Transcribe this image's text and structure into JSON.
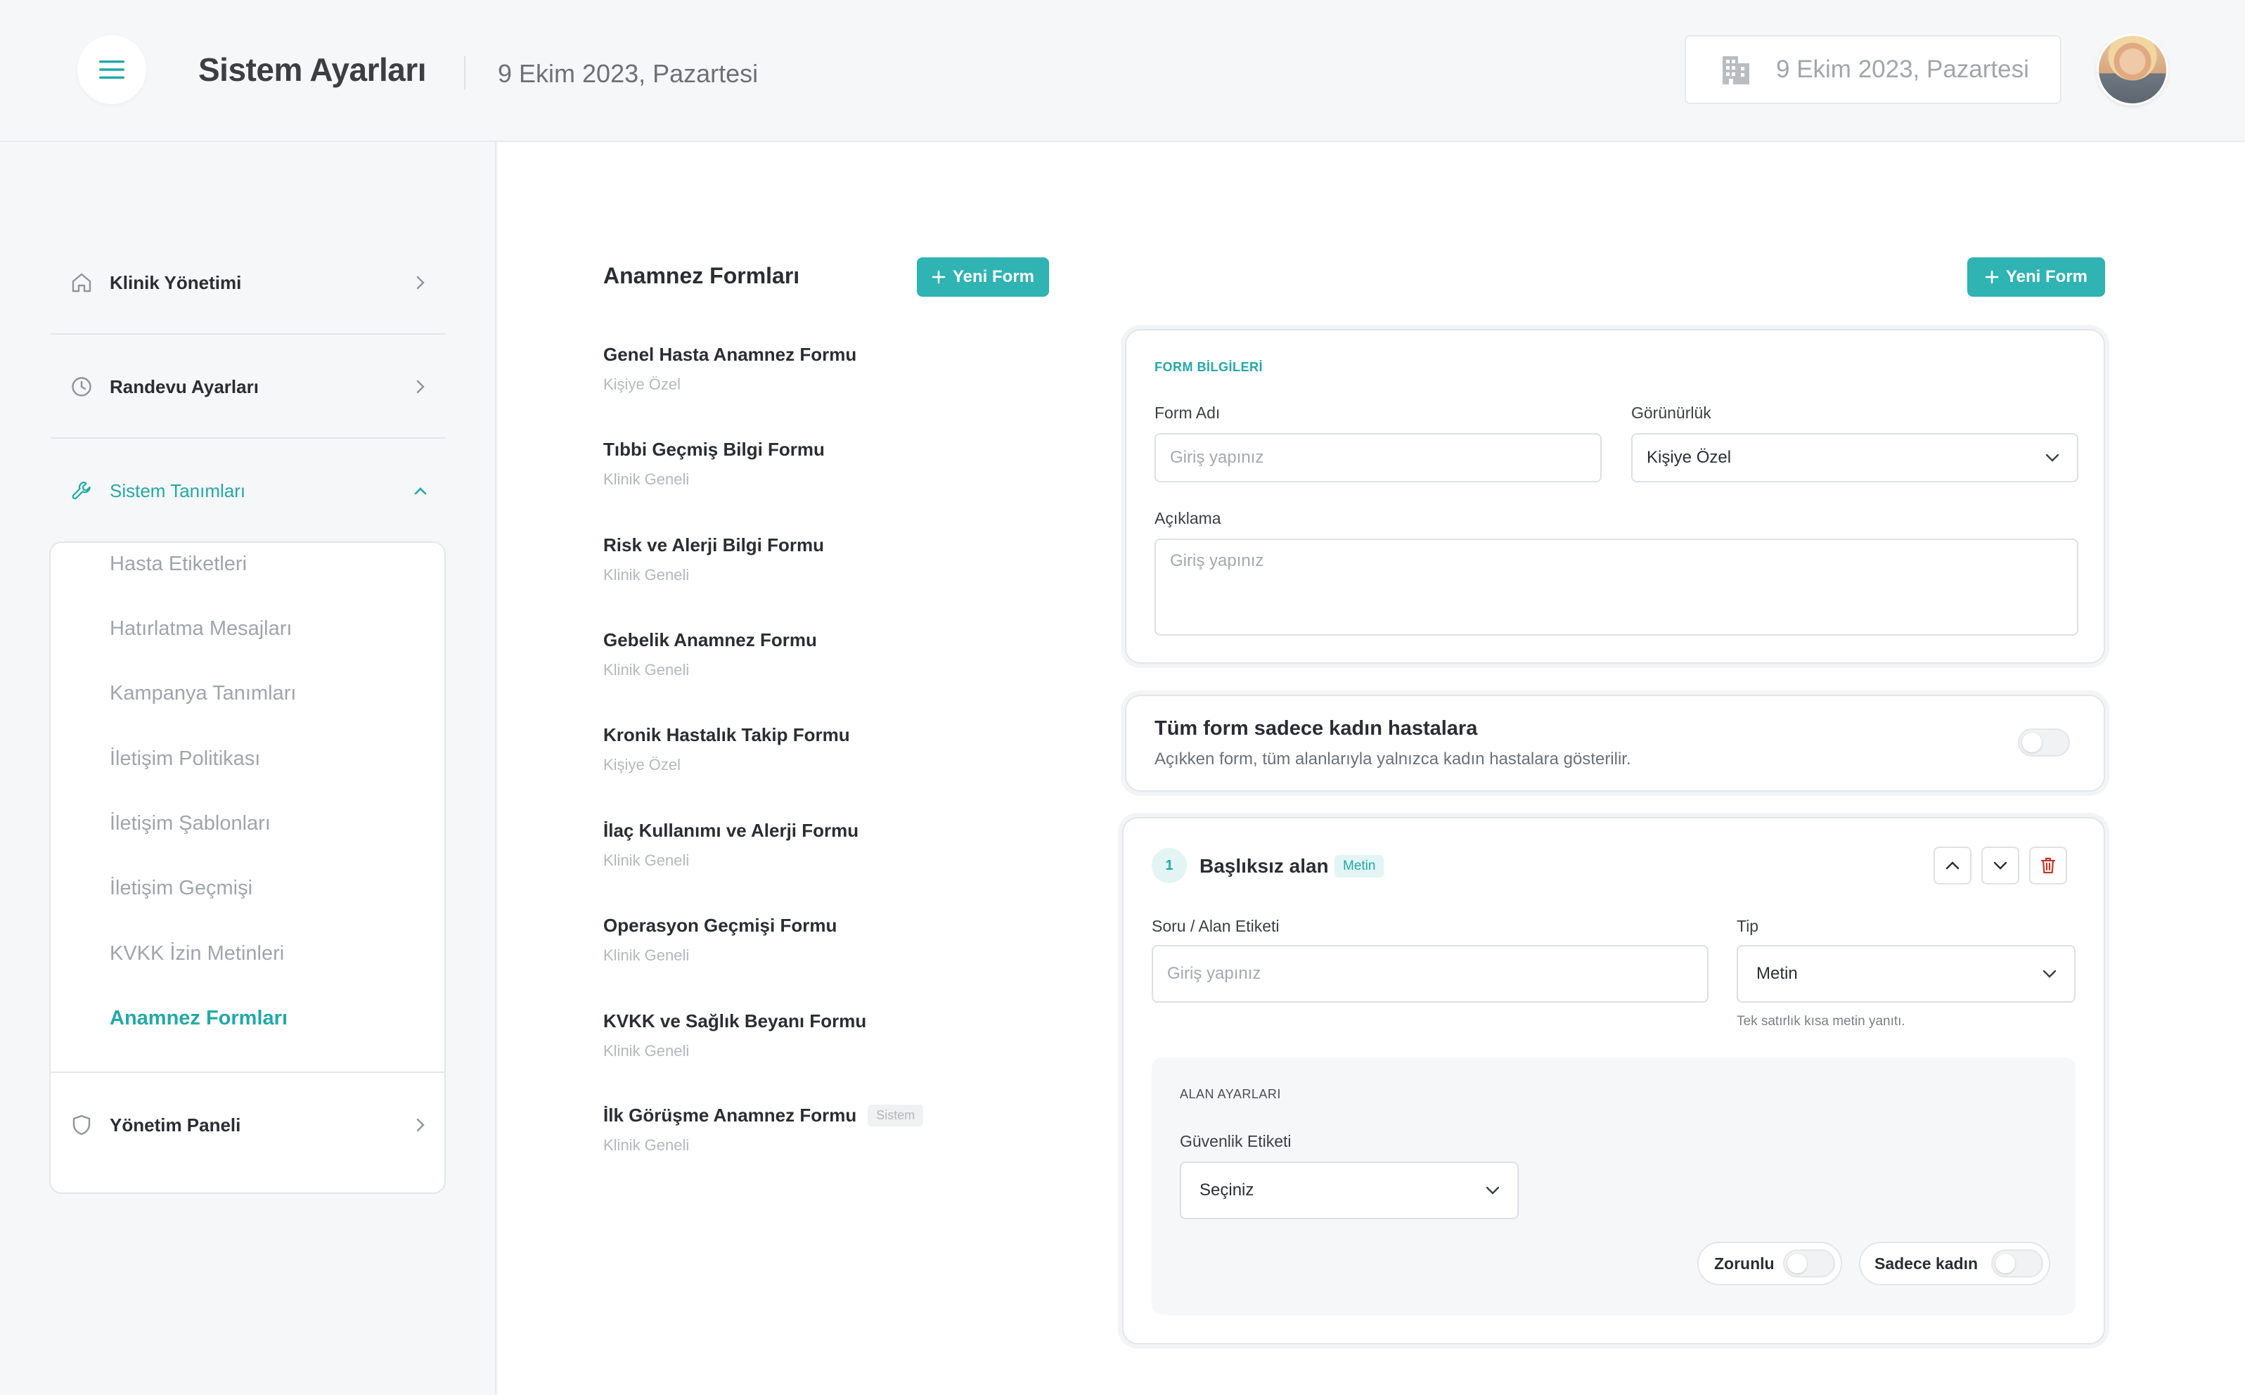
{
  "header": {
    "title": "Sistem Ayarları",
    "date": "9 Ekim 2023, Pazartesi",
    "clinic_date": "9 Ekim 2023, Pazartesi",
    "menu_icon": "hamburger-menu-icon",
    "clinic_icon": "building-icon"
  },
  "sidebar": {
    "items": [
      {
        "label": "Klinik Yönetimi",
        "icon": "home-icon"
      },
      {
        "label": "Randevu Ayarları",
        "icon": "clock-icon"
      },
      {
        "label": "Sistem Tanımları",
        "icon": "wrench-icon",
        "expanded": true
      },
      {
        "label": "Yönetim Paneli",
        "icon": "shield-icon"
      }
    ],
    "subitems": [
      "Hasta Etiketleri",
      "Hatırlatma Mesajları",
      "Kampanya Tanımları",
      "İletişim Politikası",
      "İletişim Şablonları",
      "İletişim Geçmişi",
      "KVKK İzin Metinleri",
      "Anamnez Formları"
    ],
    "active_subitem": "Anamnez Formları"
  },
  "list": {
    "title": "Anamnez Formları",
    "new_button": "Yeni Form",
    "forms": [
      {
        "name": "Genel Hasta Anamnez Formu",
        "scope": "Kişiye Özel"
      },
      {
        "name": "Tıbbi Geçmiş Bilgi Formu",
        "scope": "Klinik Geneli"
      },
      {
        "name": "Risk ve Alerji Bilgi Formu",
        "scope": "Klinik Geneli"
      },
      {
        "name": "Gebelik Anamnez Formu",
        "scope": "Klinik Geneli"
      },
      {
        "name": "Kronik Hastalık Takip Formu",
        "scope": "Kişiye Özel"
      },
      {
        "name": "İlaç Kullanımı ve Alerji Formu",
        "scope": "Klinik Geneli"
      },
      {
        "name": "Operasyon Geçmişi Formu",
        "scope": "Klinik Geneli"
      },
      {
        "name": "KVKK ve Sağlık Beyanı Formu",
        "scope": "Klinik Geneli"
      },
      {
        "name": "İlk Görüşme Anamnez Formu",
        "scope": "Klinik Geneli",
        "badge": "Sistem"
      }
    ]
  },
  "editor": {
    "new_button": "Yeni Form",
    "form_info": {
      "section_title": "FORM BİLGİLERİ",
      "name_label": "Form Adı",
      "name_placeholder": "Giriş yapınız",
      "visibility_label": "Görünürlük",
      "visibility_value": "Kişiye Özel",
      "description_label": "Açıklama",
      "description_placeholder": "Giriş yapınız"
    },
    "women_only": {
      "title": "Tüm form sadece kadın hastalara",
      "description": "Açıkken form, tüm alanlarıyla yalnızca kadın hastalara gösterilir.",
      "enabled": false
    },
    "field": {
      "number": "1",
      "title": "Başlıksız alan",
      "type_badge": "Metin",
      "question_label": "Soru / Alan Etiketi",
      "question_placeholder": "Giriş yapınız",
      "type_label": "Tip",
      "type_value": "Metin",
      "type_hint": "Tek satırlık kısa metin yanıtı.",
      "settings_title": "ALAN AYARLARI",
      "security_label": "Güvenlik Etiketi",
      "security_value": "Seçiniz",
      "required_label": "Zorunlu",
      "women_only_label": "Sadece kadın",
      "required": false,
      "women_only": false
    }
  },
  "colors": {
    "accent": "#2fb3b3",
    "accent_text": "#22a9a9",
    "danger": "#c0392b"
  }
}
